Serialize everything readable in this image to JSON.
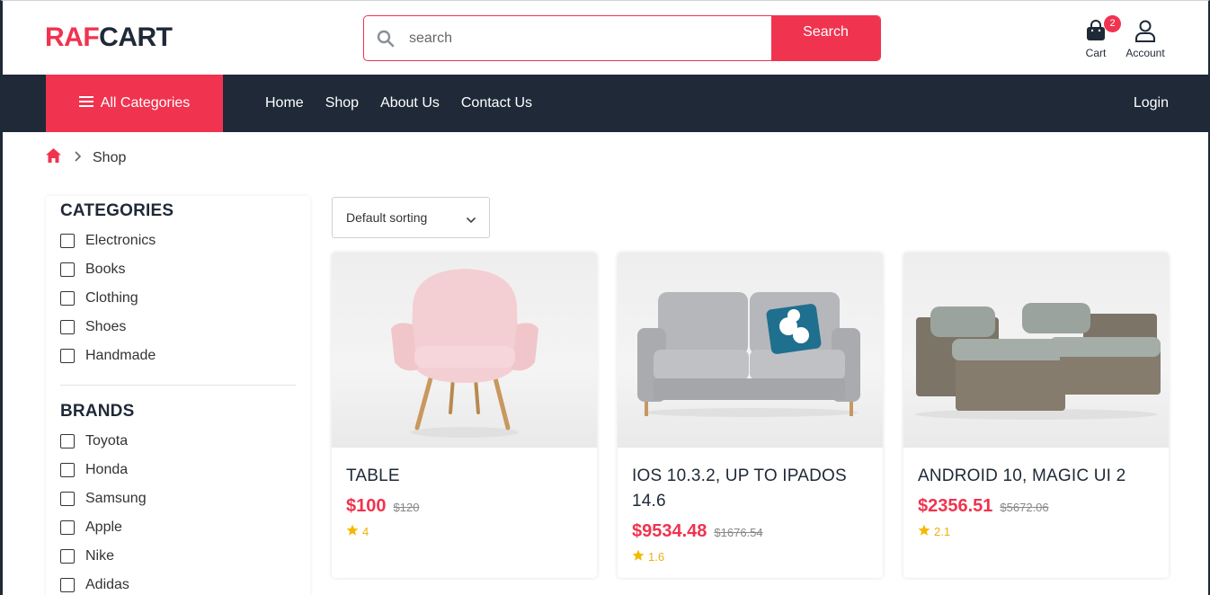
{
  "brand": {
    "part1": "RAF",
    "part2": "CART"
  },
  "search": {
    "placeholder": "search",
    "button_label": "Search"
  },
  "header_icons": {
    "cart_label": "Cart",
    "cart_count": "2",
    "account_label": "Account"
  },
  "nav": {
    "all_categories": "All Categories",
    "links": [
      "Home",
      "Shop",
      "About Us",
      "Contact Us"
    ],
    "login": "Login"
  },
  "breadcrumb": {
    "current": "Shop"
  },
  "sidebar": {
    "categories_title": "CATEGORIES",
    "categories": [
      "Electronics",
      "Books",
      "Clothing",
      "Shoes",
      "Handmade"
    ],
    "brands_title": "BRANDS",
    "brands": [
      "Toyota",
      "Honda",
      "Samsung",
      "Apple",
      "Nike",
      "Adidas"
    ]
  },
  "sort": {
    "selected": "Default sorting"
  },
  "products": [
    {
      "title": "TABLE",
      "price": "$100",
      "old_price": "$120",
      "rating": "4"
    },
    {
      "title": "IOS 10.3.2, UP TO IPADOS 14.6",
      "price": "$9534.48",
      "old_price": "$1676.54",
      "rating": "1.6"
    },
    {
      "title": "ANDROID 10, MAGIC UI 2",
      "price": "$2356.51",
      "old_price": "$5672.06",
      "rating": "2.1"
    }
  ],
  "colors": {
    "accent": "#f0334f",
    "nav_bg": "#1f2937",
    "star": "#f5b800"
  }
}
